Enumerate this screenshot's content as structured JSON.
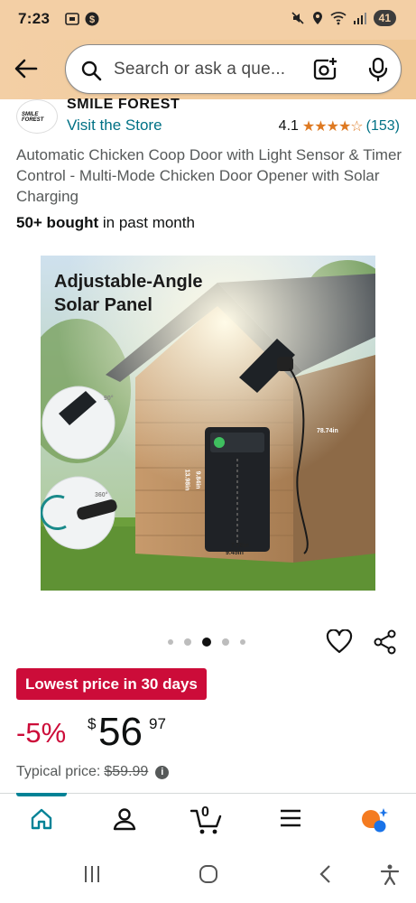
{
  "status_bar": {
    "time": "7:23",
    "battery": "41"
  },
  "search": {
    "placeholder": "Search or ask a que..."
  },
  "store": {
    "logo_text": "SMILE FOREST",
    "name": "SMILE FOREST",
    "visit_label": "Visit the Store"
  },
  "rating": {
    "value": "4.1",
    "stars": "★★★★☆",
    "stars_numeric": 4.1,
    "count": "(153)"
  },
  "product": {
    "title": "Automatic Chicken Coop Door with Light Sensor & Timer Control - Multi-Mode Chicken Door Opener with Solar Charging",
    "bought_bold": "50+ bought",
    "bought_rest": " in past month"
  },
  "image": {
    "headline_line1": "Adjustable-Angle",
    "headline_line2": "Solar Panel",
    "cable_length": "78.74in",
    "height_outer": "13.98in",
    "height_inner": "9.84in",
    "width_inner": "7.78in",
    "width_outer": "9.45in",
    "tilt_angle": "90°",
    "rotation_angle": "360°"
  },
  "carousel": {
    "total": 5,
    "active_index": 2
  },
  "deal": {
    "badge": "Lowest price in 30 days"
  },
  "price": {
    "discount": "-5%",
    "symbol": "$",
    "whole": "56",
    "fraction": "97",
    "typical_label": "Typical price:",
    "typical_value": "$59.99"
  },
  "cart": {
    "count": "0"
  },
  "colors": {
    "accent_teal": "#007185",
    "deal_red": "#cc0c39",
    "star_orange": "#de7921",
    "header_peach": "#f3cfa5"
  }
}
